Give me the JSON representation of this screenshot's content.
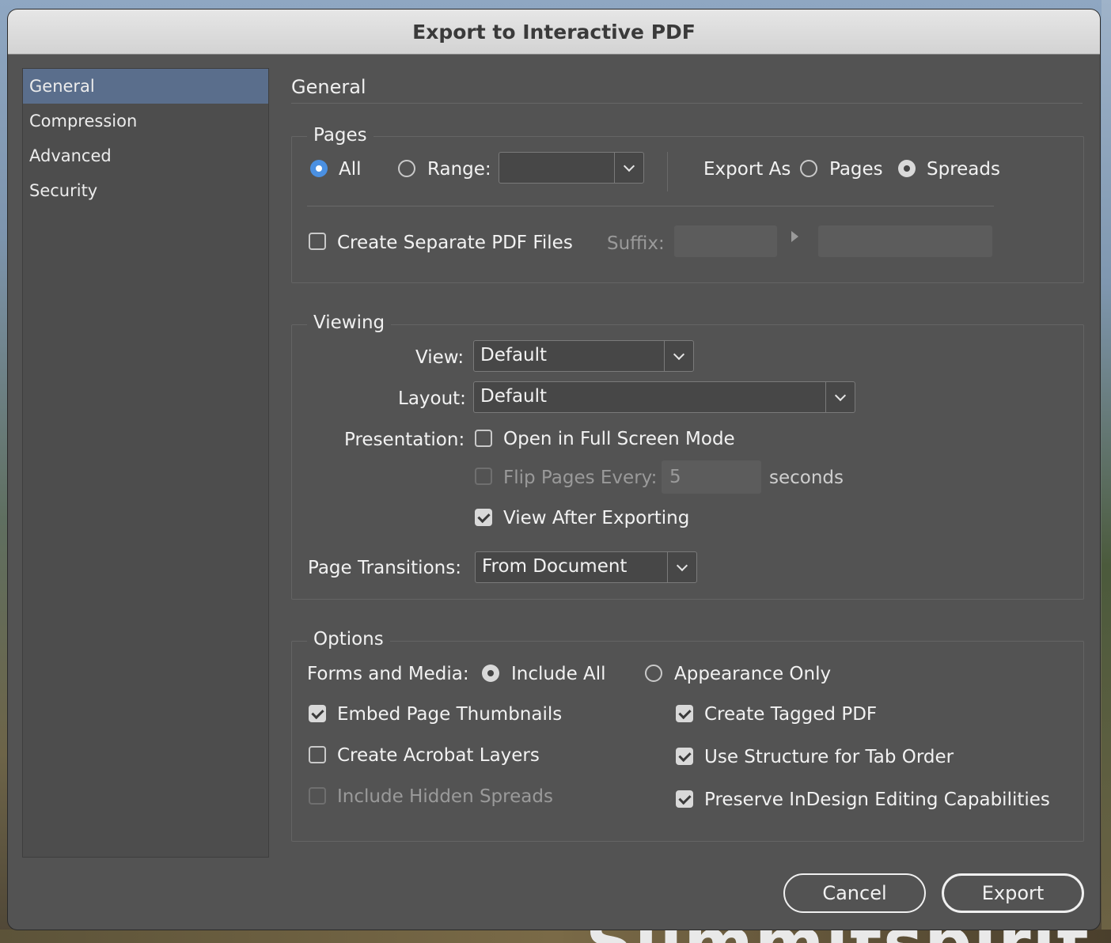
{
  "window": {
    "title": "Export to Interactive PDF"
  },
  "background": {
    "partial_text": "Summitspirit"
  },
  "sidebar": {
    "items": [
      {
        "label": "General"
      },
      {
        "label": "Compression"
      },
      {
        "label": "Advanced"
      },
      {
        "label": "Security"
      }
    ],
    "selected": "General"
  },
  "main": {
    "title": "General"
  },
  "pages": {
    "group_label": "Pages",
    "all_label": "All",
    "range_label": "Range:",
    "range_value": "",
    "export_as_label": "Export As",
    "pages_option": "Pages",
    "spreads_option": "Spreads",
    "selected_range": "All",
    "selected_export_as": "Spreads",
    "separate_files_label": "Create Separate PDF Files",
    "separate_files_checked": false,
    "suffix_label": "Suffix:"
  },
  "viewing": {
    "group_label": "Viewing",
    "view_label": "View:",
    "view_value": "Default",
    "layout_label": "Layout:",
    "layout_value": "Default",
    "presentation_label": "Presentation:",
    "full_screen_label": "Open in Full Screen Mode",
    "full_screen_checked": false,
    "flip_pages_label": "Flip Pages Every:",
    "flip_pages_value": "5",
    "flip_pages_unit": "seconds",
    "flip_pages_enabled": false,
    "view_after_label": "View After Exporting",
    "view_after_checked": true,
    "transitions_label": "Page Transitions:",
    "transitions_value": "From Document"
  },
  "options": {
    "group_label": "Options",
    "forms_label": "Forms and Media:",
    "include_all_label": "Include All",
    "appearance_only_label": "Appearance Only",
    "forms_selected": "Include All",
    "embed_thumbnails_label": "Embed Page Thumbnails",
    "embed_thumbnails_checked": true,
    "acrobat_layers_label": "Create Acrobat Layers",
    "acrobat_layers_checked": false,
    "hidden_spreads_label": "Include Hidden Spreads",
    "hidden_spreads_enabled": false,
    "tagged_pdf_label": "Create Tagged PDF",
    "tagged_pdf_checked": true,
    "tab_order_label": "Use Structure for Tab Order",
    "tab_order_checked": true,
    "preserve_label": "Preserve InDesign Editing Capabilities",
    "preserve_checked": true
  },
  "buttons": {
    "cancel": "Cancel",
    "export": "Export"
  }
}
